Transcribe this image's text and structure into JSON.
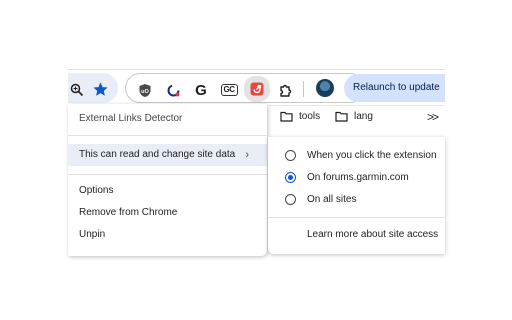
{
  "toolbar": {
    "zoom_icon": "magnifier-icon",
    "bookmark_star_icon": "star-icon",
    "extensions": [
      {
        "name": "ublock-icon"
      },
      {
        "name": "sync-icon"
      },
      {
        "name": "google-icon",
        "label": "G"
      },
      {
        "name": "gc-icon",
        "label": "GC"
      },
      {
        "name": "external-links-detector-icon"
      },
      {
        "name": "puzzle-icon"
      }
    ],
    "relaunch_label": "Relaunch to update"
  },
  "bookmarks": {
    "items": [
      {
        "label": "tools",
        "icon": "folder-icon"
      },
      {
        "label": "lang",
        "icon": "folder-icon"
      }
    ],
    "more_label": ">>"
  },
  "menu": {
    "title": "External Links Detector",
    "site_data_label": "This can read and change site data",
    "site_data_chevron": "›",
    "options_label": "Options",
    "remove_label": "Remove from Chrome",
    "unpin_label": "Unpin"
  },
  "submenu": {
    "options": [
      {
        "label": "When you click the extension",
        "checked": false
      },
      {
        "label": "On forums.garmin.com",
        "checked": true
      },
      {
        "label": "On all sites",
        "checked": false
      }
    ],
    "learn_more_label": "Learn more about site access"
  },
  "colors": {
    "accent": "#0b57d0",
    "relaunch_bg": "#d3e3fd",
    "hover_bg": "#e9eef6",
    "ext_active_icon": "#e8453c"
  }
}
